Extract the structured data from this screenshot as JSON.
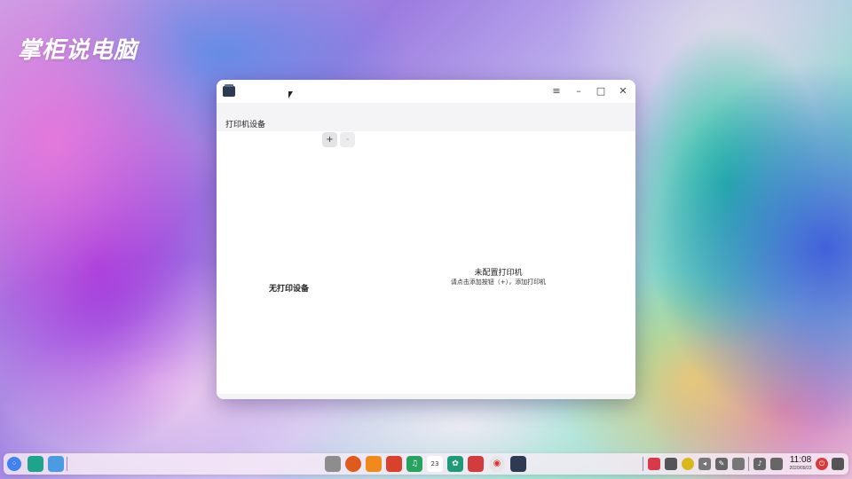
{
  "desktop": {
    "logo_text": "掌柜说电脑"
  },
  "window": {
    "menu_glyph": "≡",
    "minimize_glyph": "–",
    "maximize_glyph": "□",
    "close_glyph": "✕",
    "sidebar_title": "打印机设备",
    "add_button": "+",
    "remove_button": "-",
    "empty_left": "无打印设备",
    "empty_right_title": "未配置打印机",
    "empty_right_hint": "请点击添加按钮（+），添加打印机"
  },
  "taskbar": {
    "clock_time": "11:08",
    "clock_date": "2020/09/23",
    "calendar_day": "23"
  },
  "colors": {
    "dock_bg": "#f8ecf6",
    "window_bg": "#ffffff",
    "accent": "#2c3a52"
  }
}
